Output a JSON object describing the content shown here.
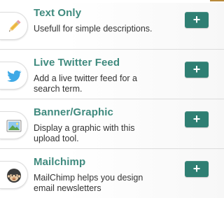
{
  "widgets": [
    {
      "title": "Text Only",
      "description": "Usefull for simple descriptions.",
      "icon": "pencil-icon",
      "add_label": "+"
    },
    {
      "title": "Live Twitter Feed",
      "description": "Add a live twitter feed for a search term.",
      "icon": "twitter-bird-icon",
      "add_label": "+"
    },
    {
      "title": "Banner/Graphic",
      "description": "Display a graphic with this upload tool.",
      "icon": "image-icon",
      "add_label": "+"
    },
    {
      "title": "Mailchimp",
      "description": "MailChimp helps you design email newsletters",
      "icon": "mailchimp-icon",
      "add_label": "+"
    }
  ],
  "colors": {
    "title": "#3f8a7e",
    "button": "#2f7f73",
    "twitter": "#3fa9e6",
    "accent_line": "#b8893a"
  }
}
